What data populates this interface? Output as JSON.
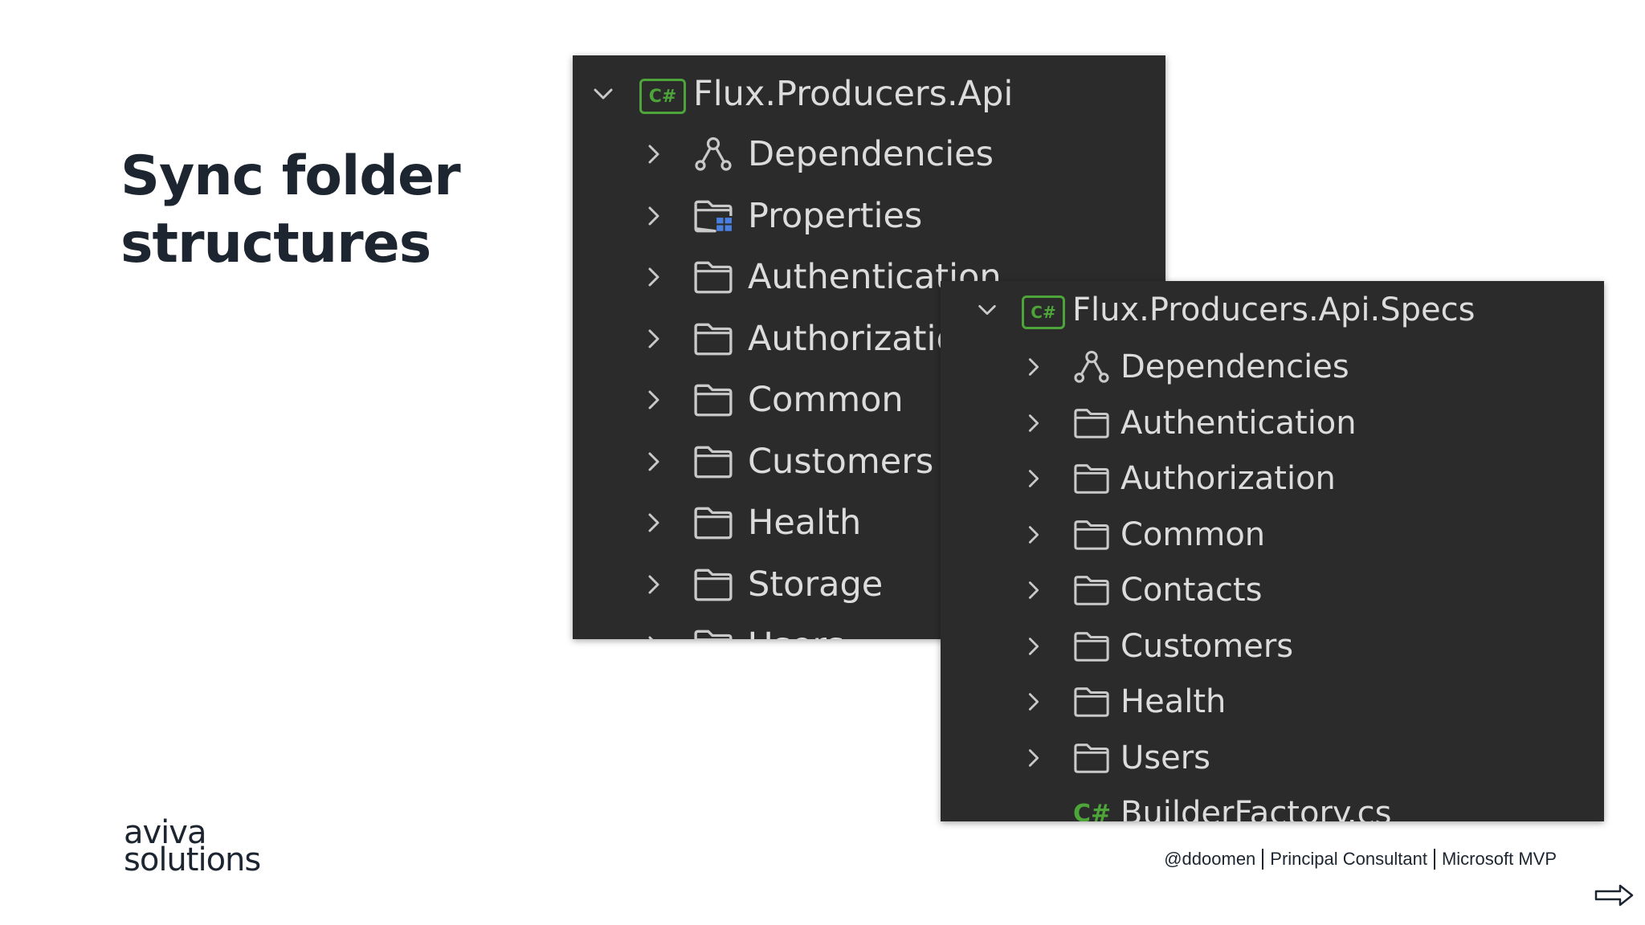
{
  "slide": {
    "title_line1": "Sync folder",
    "title_line2": "structures"
  },
  "panel_api": {
    "root_badge": "C#",
    "root_label": "Flux.Producers.Api",
    "items": [
      {
        "icon": "dependencies-icon",
        "label": "Dependencies"
      },
      {
        "icon": "properties-folder-icon",
        "label": "Properties"
      },
      {
        "icon": "folder-icon",
        "label": "Authentication"
      },
      {
        "icon": "folder-icon",
        "label": "Authorization"
      },
      {
        "icon": "folder-icon",
        "label": "Common"
      },
      {
        "icon": "folder-icon",
        "label": "Customers"
      },
      {
        "icon": "folder-icon",
        "label": "Health"
      },
      {
        "icon": "folder-icon",
        "label": "Storage"
      },
      {
        "icon": "folder-icon",
        "label": "Users"
      }
    ]
  },
  "panel_specs": {
    "root_badge": "C#",
    "root_label": "Flux.Producers.Api.Specs",
    "items": [
      {
        "icon": "dependencies-icon",
        "label": "Dependencies"
      },
      {
        "icon": "folder-icon",
        "label": "Authentication"
      },
      {
        "icon": "folder-icon",
        "label": "Authorization"
      },
      {
        "icon": "folder-icon",
        "label": "Common"
      },
      {
        "icon": "folder-icon",
        "label": "Contacts"
      },
      {
        "icon": "folder-icon",
        "label": "Customers"
      },
      {
        "icon": "folder-icon",
        "label": "Health"
      },
      {
        "icon": "folder-icon",
        "label": "Users"
      }
    ],
    "file": {
      "icon": "csharp-file-icon",
      "badge": "C#",
      "label": "BuilderFactory.cs"
    }
  },
  "footer": {
    "logo_line1": "aviva",
    "logo_line2": "solutions",
    "handle": "@ddoomen",
    "role": "Principal Consultant",
    "award": "Microsoft MVP"
  },
  "colors": {
    "panel_bg": "#2b2b2b",
    "tree_text": "#dcdcdc",
    "csharp_green": "#4da53a",
    "properties_blue": "#4a7fe0",
    "title_text": "#1c2530"
  }
}
